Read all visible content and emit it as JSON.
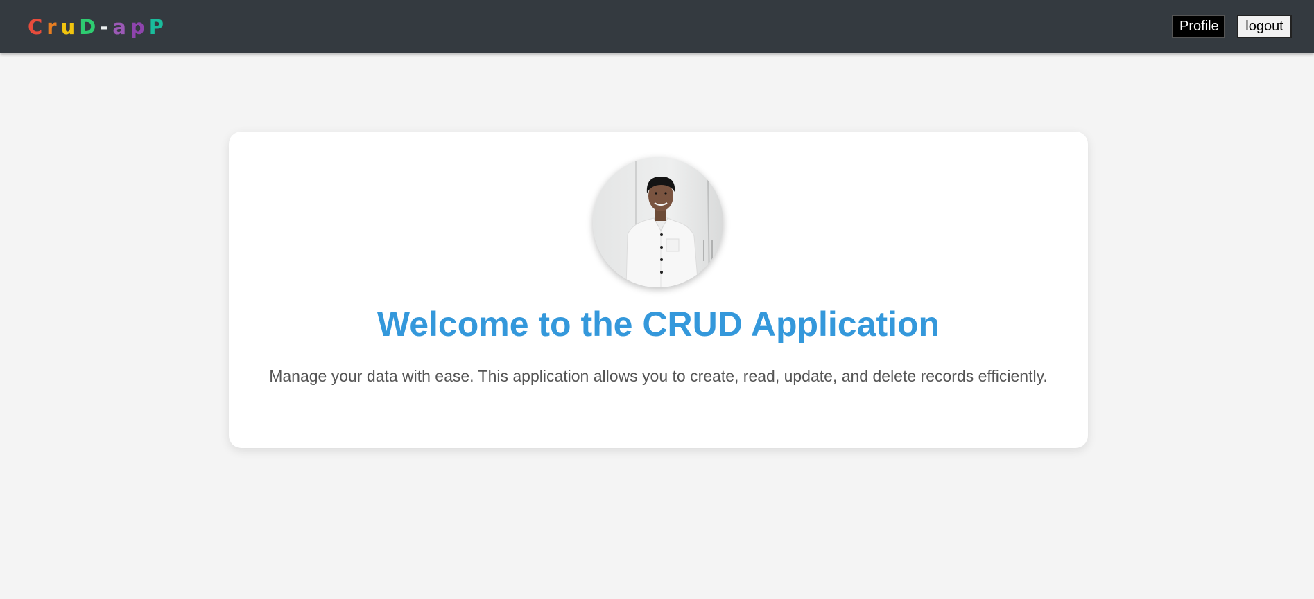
{
  "navbar": {
    "logo_letters": [
      {
        "char": "C",
        "color": "#e74c3c"
      },
      {
        "char": "r",
        "color": "#e67e22"
      },
      {
        "char": "u",
        "color": "#f1c40f"
      },
      {
        "char": "D",
        "color": "#2ecc71"
      },
      {
        "char": "-",
        "color": "#ecf0f1"
      },
      {
        "char": "a",
        "color": "#9b59b6"
      },
      {
        "char": "p",
        "color": "#8e44ad"
      },
      {
        "char": "P",
        "color": "#1abc9c"
      }
    ],
    "profile_label": "Profile",
    "logout_label": "logout"
  },
  "main": {
    "title": "Welcome to the CRUD Application",
    "description": "Manage your data with ease. This application allows you to create, read, update, and delete records efficiently."
  },
  "colors": {
    "navbar_bg": "#343a40",
    "title": "#3498db",
    "page_bg": "#f4f4f4"
  }
}
